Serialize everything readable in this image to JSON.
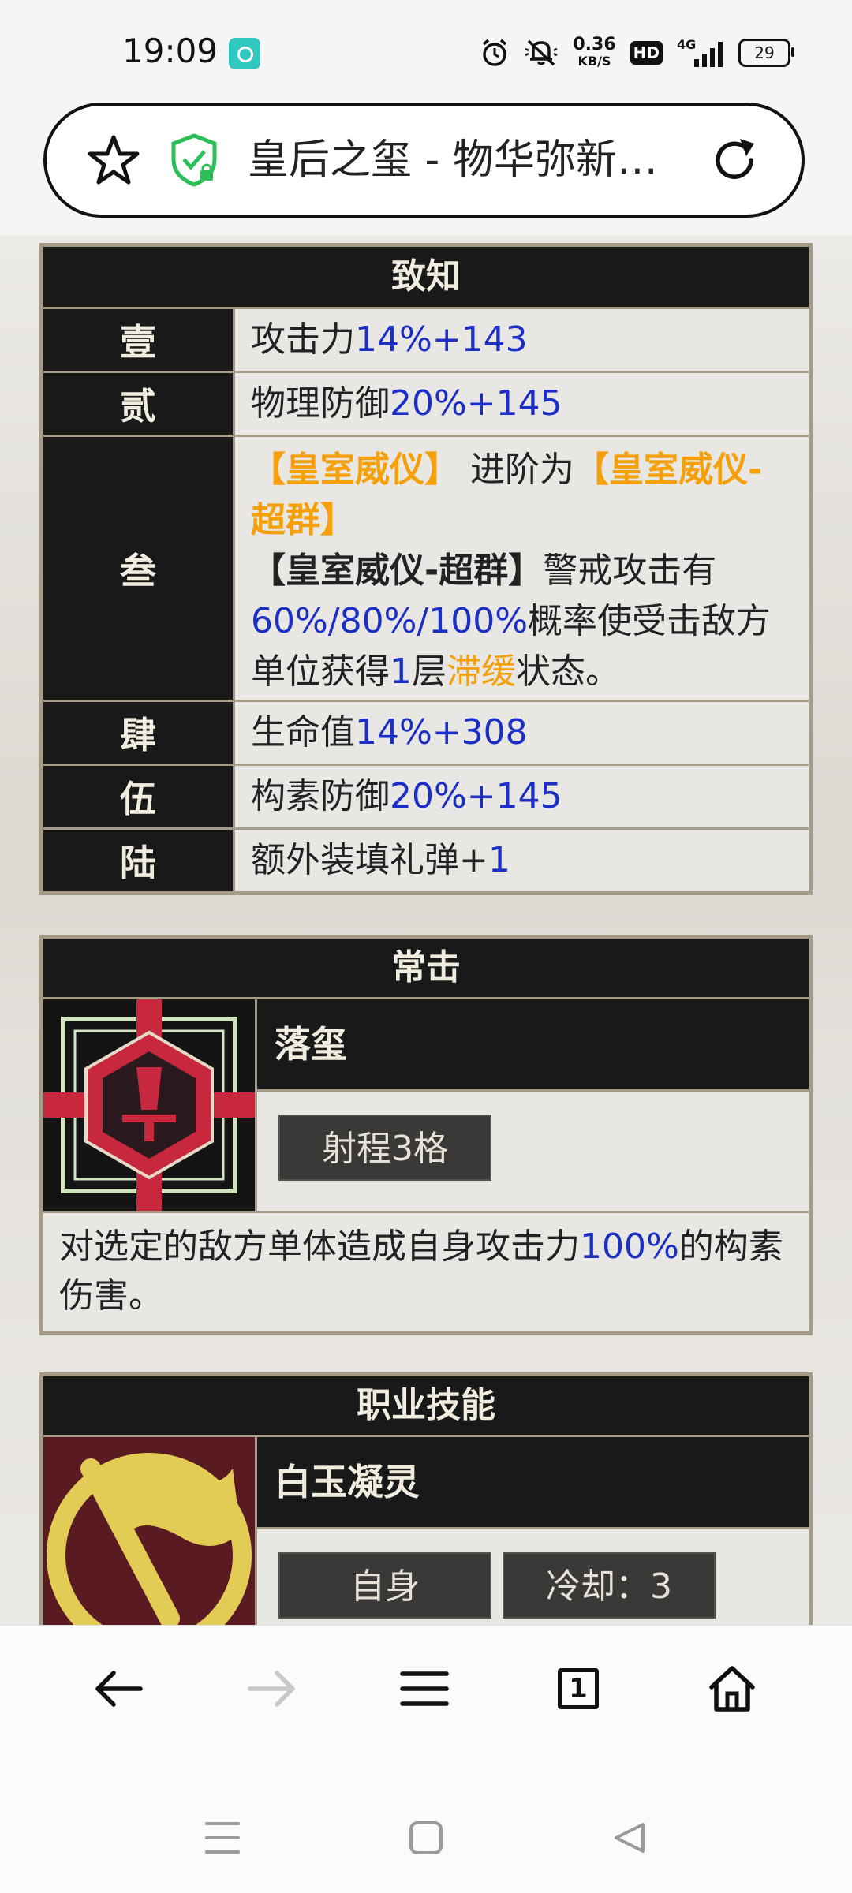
{
  "status_bar": {
    "time": "19:09",
    "speed_value": "0.36",
    "speed_unit": "KB/S",
    "hd": "HD",
    "network": "4G",
    "battery": "29",
    "icons": [
      "app-notification-icon",
      "alarm-icon",
      "mute-icon",
      "speed-indicator",
      "hd-icon",
      "signal-icon",
      "battery-icon"
    ]
  },
  "address_bar": {
    "title": "皇后之玺 - 物华弥新…",
    "icons": [
      "bookmark-star-icon",
      "secure-shield-icon",
      "reload-icon"
    ],
    "shield_color": "#2dbf5a"
  },
  "zhizhi_table": {
    "header": "致知",
    "rows": [
      {
        "label": "壹",
        "text": "攻击力",
        "blue": "14%+143"
      },
      {
        "label": "贰",
        "text": "物理防御",
        "blue": "20%+145"
      },
      {
        "label": "叁",
        "orange1": "【皇室威仪】",
        "mid": " 进阶为",
        "orange2": "【皇室威仪-超群】",
        "bold": "【皇室威仪-超群】",
        "after_bold": "警戒攻击有",
        "blue_pct": "60%/80%/100%",
        "after_pct": "概率使受击敌方单位获得",
        "blue_num": "1",
        "after_num": "层",
        "orange3": "滞缓",
        "end": "状态。"
      },
      {
        "label": "肆",
        "text": "生命值",
        "blue": "14%+308"
      },
      {
        "label": "伍",
        "text": "构素防御",
        "blue": "20%+145"
      },
      {
        "label": "陆",
        "text": "额外装填礼弹+",
        "blue": "1"
      }
    ]
  },
  "normal_attack": {
    "header": "常击",
    "skill_name": "落玺",
    "range_tag": "射程3格",
    "desc_before": "对选定的敌方单体造成自身攻击力",
    "desc_blue": "100%",
    "desc_after": "的构素伤害。"
  },
  "class_skill": {
    "header": "职业技能",
    "skill_name": "白玉凝灵",
    "target_tag": "自身",
    "cooldown_tag": "冷却：3"
  },
  "toolbar": {
    "items": [
      "back-arrow-icon",
      "forward-arrow-icon",
      "menu-icon",
      "tabs-icon",
      "home-icon"
    ],
    "tab_count": "1"
  },
  "nav_bar": {
    "items": [
      "recent-apps-icon",
      "home-square-icon",
      "back-triangle-icon"
    ]
  },
  "colors": {
    "header_bg": "#191919",
    "border": "#a69b86",
    "value_blue": "#1b2fc7",
    "highlight_orange": "#f5a00b"
  }
}
